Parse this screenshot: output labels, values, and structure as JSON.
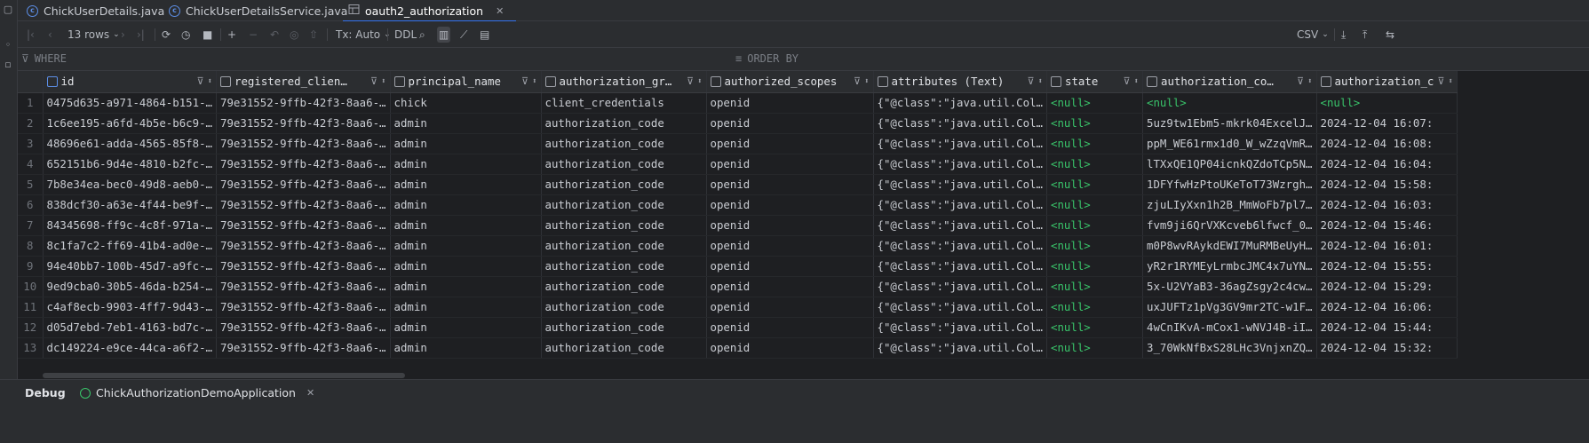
{
  "tabs": [
    {
      "label": "ChickUserDetails.java",
      "icon": "class-icon",
      "active": false
    },
    {
      "label": "ChickUserDetailsService.java",
      "icon": "class-icon",
      "active": false
    },
    {
      "label": "oauth2_authorization",
      "icon": "table-icon",
      "active": true
    }
  ],
  "toolbar": {
    "rows_label": "13 rows",
    "tx_label": "Tx: Auto",
    "ddl_label": "DDL",
    "export_format": "CSV"
  },
  "filters": {
    "where_label": "WHERE",
    "order_by_label": "ORDER BY"
  },
  "columns": [
    {
      "name": "id",
      "key": true
    },
    {
      "name": "registered_clien…",
      "key": false
    },
    {
      "name": "principal_name",
      "key": false
    },
    {
      "name": "authorization_gr…",
      "key": false
    },
    {
      "name": "authorized_scopes",
      "key": false
    },
    {
      "name": "attributes (Text)",
      "key": false
    },
    {
      "name": "state",
      "key": false
    },
    {
      "name": "authorization_co…",
      "key": false
    },
    {
      "name": "authorization_c",
      "key": false
    }
  ],
  "rows": [
    [
      "1",
      "0475d635-a971-4864-b151-…",
      "79e31552-9ffb-42f3-8aa6-…",
      "chick",
      "client_credentials",
      "openid",
      "{\"@class\":\"java.util.Col…",
      "<null>",
      "<null>",
      "<null>"
    ],
    [
      "2",
      "1c6ee195-a6fd-4b5e-b6c9-…",
      "79e31552-9ffb-42f3-8aa6-…",
      "admin",
      "authorization_code",
      "openid",
      "{\"@class\":\"java.util.Col…",
      "<null>",
      "5uz9tw1Ebm5-mkrk04ExcelJ…",
      "2024-12-04 16:07:"
    ],
    [
      "3",
      "48696e61-adda-4565-85f8-…",
      "79e31552-9ffb-42f3-8aa6-…",
      "admin",
      "authorization_code",
      "openid",
      "{\"@class\":\"java.util.Col…",
      "<null>",
      "ppM_WE61rmx1d0_W_wZzqVmR…",
      "2024-12-04 16:08:"
    ],
    [
      "4",
      "652151b6-9d4e-4810-b2fc-…",
      "79e31552-9ffb-42f3-8aa6-…",
      "admin",
      "authorization_code",
      "openid",
      "{\"@class\":\"java.util.Col…",
      "<null>",
      "lTXxQE1QP04icnkQZdoTCp5N…",
      "2024-12-04 16:04:"
    ],
    [
      "5",
      "7b8e34ea-bec0-49d8-aeb0-…",
      "79e31552-9ffb-42f3-8aa6-…",
      "admin",
      "authorization_code",
      "openid",
      "{\"@class\":\"java.util.Col…",
      "<null>",
      "1DFYfwHzPtoUKeToT73Wzrgh…",
      "2024-12-04 15:58:"
    ],
    [
      "6",
      "838dcf30-a63e-4f44-be9f-…",
      "79e31552-9ffb-42f3-8aa6-…",
      "admin",
      "authorization_code",
      "openid",
      "{\"@class\":\"java.util.Col…",
      "<null>",
      "zjuLIyXxn1h2B_MmWoFb7pl7…",
      "2024-12-04 16:03:"
    ],
    [
      "7",
      "84345698-ff9c-4c8f-971a-…",
      "79e31552-9ffb-42f3-8aa6-…",
      "admin",
      "authorization_code",
      "openid",
      "{\"@class\":\"java.util.Col…",
      "<null>",
      "fvm9ji6QrVXKcveb6lfwcf_0…",
      "2024-12-04 15:46:"
    ],
    [
      "8",
      "8c1fa7c2-ff69-41b4-ad0e-…",
      "79e31552-9ffb-42f3-8aa6-…",
      "admin",
      "authorization_code",
      "openid",
      "{\"@class\":\"java.util.Col…",
      "<null>",
      "m0P8wvRAykdEWI7MuRMBeUyH…",
      "2024-12-04 16:01:"
    ],
    [
      "9",
      "94e40bb7-100b-45d7-a9fc-…",
      "79e31552-9ffb-42f3-8aa6-…",
      "admin",
      "authorization_code",
      "openid",
      "{\"@class\":\"java.util.Col…",
      "<null>",
      "yR2r1RYMEyLrmbcJMC4x7uYN…",
      "2024-12-04 15:55:"
    ],
    [
      "10",
      "9ed9cba0-30b5-46da-b254-…",
      "79e31552-9ffb-42f3-8aa6-…",
      "admin",
      "authorization_code",
      "openid",
      "{\"@class\":\"java.util.Col…",
      "<null>",
      "5x-U2VYaB3-36agZsgy2c4cw…",
      "2024-12-04 15:29:"
    ],
    [
      "11",
      "c4af8ecb-9903-4ff7-9d43-…",
      "79e31552-9ffb-42f3-8aa6-…",
      "admin",
      "authorization_code",
      "openid",
      "{\"@class\":\"java.util.Col…",
      "<null>",
      "uxJUFTz1pVg3GV9mr2TC-w1F…",
      "2024-12-04 16:06:"
    ],
    [
      "12",
      "d05d7ebd-7eb1-4163-bd7c-…",
      "79e31552-9ffb-42f3-8aa6-…",
      "admin",
      "authorization_code",
      "openid",
      "{\"@class\":\"java.util.Col…",
      "<null>",
      "4wCnIKvA-mCox1-wNVJ4B-iI…",
      "2024-12-04 15:44:"
    ],
    [
      "13",
      "dc149224-e9ce-44ca-a6f2-…",
      "79e31552-9ffb-42f3-8aa6-…",
      "admin",
      "authorization_code",
      "openid",
      "{\"@class\":\"java.util.Col…",
      "<null>",
      "3_70WkNfBxS28LHc3VnjxnZQ…",
      "2024-12-04 15:32:"
    ]
  ],
  "bottom": {
    "debug_label": "Debug",
    "app_label": "ChickAuthorizationDemoApplication"
  },
  "colors": {
    "background": "#1e1f22",
    "panel": "#2b2d30",
    "accent": "#3574f0",
    "null_text": "#39c46a"
  }
}
